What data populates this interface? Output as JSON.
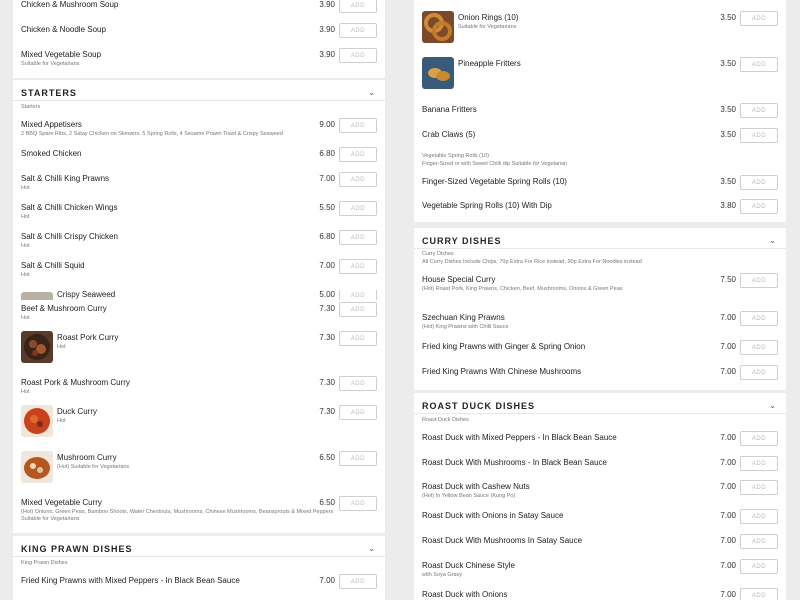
{
  "add_label": "ADD",
  "chevron_glyph": "⌄",
  "left": {
    "soups": [
      {
        "name": "Chicken & Mushroom Soup",
        "price": "3.90"
      },
      {
        "name": "Chicken & Noodle Soup",
        "price": "3.90"
      },
      {
        "name": "Mixed Vegetable Soup",
        "price": "3.90",
        "desc": "Suitable for Vegetarians"
      }
    ],
    "starters_title": "STARTERS",
    "starters_sub": "Starters",
    "starters": [
      {
        "name": "Mixed Appetisers",
        "price": "9.00",
        "desc": "2 BBQ Spare Ribs, 2 Satay Chicken on Skewers, 5 Spring Rolls, 4 Sesame Prawn Toast & Crispy Seaweed"
      },
      {
        "name": "Smoked Chicken",
        "price": "6.80"
      },
      {
        "name": "Salt & Chilli King Prawns",
        "price": "7.00",
        "desc": "Hot"
      },
      {
        "name": "Salt & Chilli Chicken Wings",
        "price": "5.50",
        "desc": "Hot"
      },
      {
        "name": "Salt & Chilli Crispy Chicken",
        "price": "6.80",
        "desc": "Hot"
      },
      {
        "name": "Salt & Chilli Squid",
        "price": "7.00",
        "desc": "Hot"
      },
      {
        "name": "Crispy Seaweed",
        "price": "5.00"
      }
    ],
    "curry": [
      {
        "name": "Beef & Mushroom Curry",
        "price": "7.30",
        "desc": "Hot"
      },
      {
        "name": "Roast Pork Curry",
        "price": "7.30",
        "desc": "Hot"
      },
      {
        "name": "Roast Pork & Mushroom Curry",
        "price": "7.30",
        "desc": "Hot"
      },
      {
        "name": "Duck Curry",
        "price": "7.30",
        "desc": "Hot"
      },
      {
        "name": "Mushroom Curry",
        "price": "6.50",
        "desc": "(Hot) Suitable for Vegetarians"
      },
      {
        "name": "Mixed Vegetable Curry",
        "price": "6.50",
        "desc": "(Hot) Onions, Green Peas, Bamboo Shoots, Water Chestnuts, Mushrooms, Chinese Mushrooms, Beansprouts & Mixed Peppers",
        "desc2": "Suitable for Vegetarians"
      }
    ],
    "kingprawn_title": "KING PRAWN DISHES",
    "kingprawn_sub": "King Prawn Dishes",
    "kingprawn": [
      {
        "name": "Fried King Prawns with Mixed Peppers - In Black Bean Sauce",
        "price": "7.00"
      }
    ]
  },
  "right": {
    "sides": [
      {
        "name": "Onion Rings (10)",
        "price": "3.50",
        "desc": "Suitable for Vegetarians"
      },
      {
        "name": "Pineapple Fritters",
        "price": "3.50"
      },
      {
        "name": "Banana Fritters",
        "price": "3.50"
      },
      {
        "name": "Crab Claws (5)",
        "price": "3.50"
      }
    ],
    "vsr_sub": "Vegetable Spring Rolls (10)",
    "vsr_sub2": "Finger-Sized or with Sweet Chilli dip Suitable for Vegetarian",
    "vsr": [
      {
        "name": "Finger-Sized Vegetable Spring Rolls (10)",
        "price": "3.50"
      },
      {
        "name": "Vegetable Spring Rolls (10) With Dip",
        "price": "3.80"
      }
    ],
    "curry_title": "CURRY DISHES",
    "curry_sub": "Curry Dishes",
    "curry_sub2": "All Curry Dishes Include Chips, 70p Extra For Rice instead, 90p Extra For Noodles instead",
    "curry": [
      {
        "name": "House Special Curry",
        "price": "7.50",
        "desc": "(Hot) Roast Pork, King Prawns, Chicken, Beef, Mushrooms, Onions & Green Peas"
      },
      {
        "name": "Szechuan King Prawns",
        "price": "7.00",
        "desc": "(Hot) King Prawns with Chilli Sauce"
      },
      {
        "name": "Fried king Prawns with Ginger & Spring Onion",
        "price": "7.00"
      },
      {
        "name": "Fried King Prawns With Chinese Mushrooms",
        "price": "7.00"
      }
    ],
    "duck_title": "ROAST DUCK DISHES",
    "duck_sub": "Roast Duck Dishes",
    "duck": [
      {
        "name": "Roast Duck with Mixed Peppers - In Black Bean Sauce",
        "price": "7.00"
      },
      {
        "name": "Roast Duck With Mushrooms - In Black Bean Sauce",
        "price": "7.00"
      },
      {
        "name": "Roast Duck with Cashew Nuts",
        "price": "7.00",
        "desc": "(Hot) In Yellow Bean Sauce (Kung Po)"
      },
      {
        "name": "Roast Duck with Onions in Satay Sauce",
        "price": "7.00"
      },
      {
        "name": "Roast Duck With Mushrooms In Satay Sauce",
        "price": "7.00"
      },
      {
        "name": "Roast Duck Chinese Style",
        "price": "7.00",
        "desc": "with Soya Gravy"
      },
      {
        "name": "Roast Duck with Onions",
        "price": "7.00"
      }
    ]
  }
}
